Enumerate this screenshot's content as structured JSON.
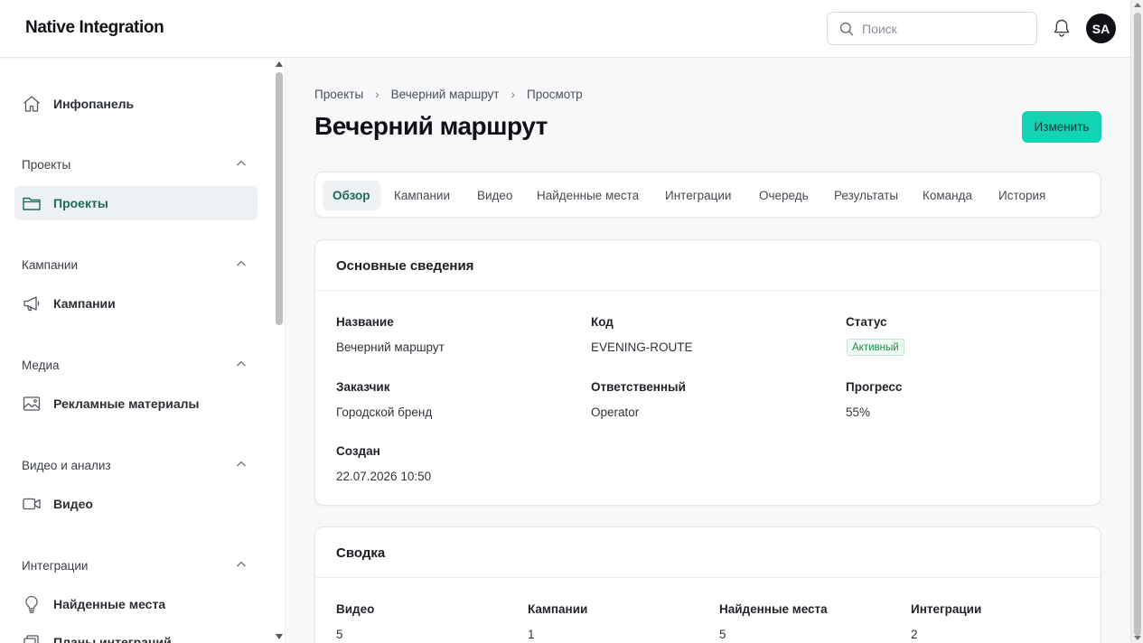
{
  "header": {
    "logo": "Native Integration",
    "search_placeholder": "Поиск",
    "avatar_initials": "SA"
  },
  "sidebar": {
    "dashboard": "Инфопанель",
    "groups": [
      {
        "title": "Проекты",
        "items": [
          "Проекты"
        ]
      },
      {
        "title": "Кампании",
        "items": [
          "Кампании"
        ]
      },
      {
        "title": "Медиа",
        "items": [
          "Рекламные материалы"
        ]
      },
      {
        "title": "Видео и анализ",
        "items": [
          "Видео"
        ]
      },
      {
        "title": "Интеграции",
        "items": [
          "Найденные места",
          "Планы интеграций"
        ]
      }
    ]
  },
  "breadcrumbs": [
    "Проекты",
    "Вечерний маршрут",
    "Просмотр"
  ],
  "page_title": "Вечерний маршрут",
  "edit_label": "Изменить",
  "tabs": [
    "Обзор",
    "Кампании",
    "Видео",
    "Найденные места",
    "Интеграции",
    "Очередь",
    "Результаты",
    "Команда",
    "История"
  ],
  "active_tab": "Обзор",
  "info": {
    "title": "Основные сведения",
    "name_label": "Название",
    "name_value": "Вечерний маршрут",
    "code_label": "Код",
    "code_value": "EVENING-ROUTE",
    "status_label": "Статус",
    "status_value": "Активный",
    "customer_label": "Заказчик",
    "customer_value": "Городской бренд",
    "owner_label": "Ответственный",
    "owner_value": "Operator",
    "progress_label": "Прогресс",
    "progress_value": "55%",
    "created_label": "Создан",
    "created_value": "22.07.2026 10:50"
  },
  "summary": {
    "title": "Сводка",
    "items": [
      {
        "label": "Видео",
        "value": "5"
      },
      {
        "label": "Кампании",
        "value": "1"
      },
      {
        "label": "Найденные места",
        "value": "5"
      },
      {
        "label": "Интеграции",
        "value": "2"
      }
    ]
  },
  "colors": {
    "accent": "#13d3b5",
    "active_text": "#1a6b5c",
    "status_green": "#1f8a4c"
  }
}
